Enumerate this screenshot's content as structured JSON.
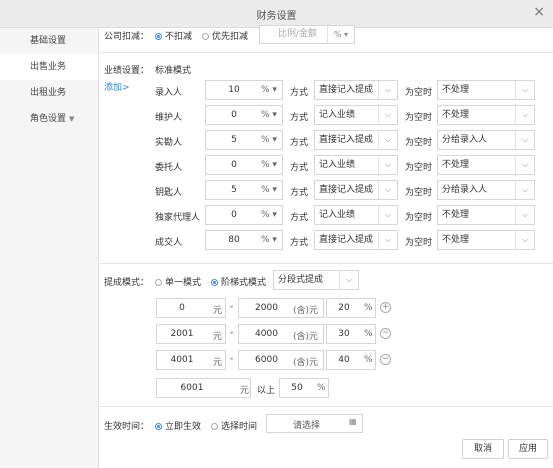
{
  "window": {
    "title": "财务设置",
    "close": "×"
  },
  "sidebar": {
    "items": [
      {
        "label": "基础设置"
      },
      {
        "label": "出售业务"
      },
      {
        "label": "出租业务"
      },
      {
        "label": "角色设置"
      }
    ],
    "caret": "▼"
  },
  "deduction": {
    "label": "公司扣减：",
    "opt1": "不扣减",
    "opt2": "优先扣减",
    "placeholder": "比例/金额",
    "unit": "% ▾"
  },
  "performance": {
    "label": "业绩设置：",
    "mode": "标准模式",
    "add": "添加>",
    "fangshi": "方式",
    "empty_label": "为空时",
    "unit": "% ▾",
    "rows": [
      {
        "role": "录入人",
        "value": "10",
        "method": "直接记入提成",
        "empty": "不处理"
      },
      {
        "role": "维护人",
        "value": "0",
        "method": "记入业绩",
        "empty": "不处理"
      },
      {
        "role": "实勘人",
        "value": "5",
        "method": "直接记入提成",
        "empty": "分给录入人"
      },
      {
        "role": "委托人",
        "value": "0",
        "method": "记入业绩",
        "empty": "不处理"
      },
      {
        "role": "钥匙人",
        "value": "5",
        "method": "直接记入提成",
        "empty": "分给录入人"
      },
      {
        "role": "独家代理人",
        "value": "0",
        "method": "记入业绩",
        "empty": "不处理"
      },
      {
        "role": "成交人",
        "value": "80",
        "method": "直接记入提成",
        "empty": "不处理"
      }
    ]
  },
  "commission": {
    "label": "提成模式：",
    "opt1": "单一模式",
    "opt2": "阶梯式模式",
    "select": "分段式提成",
    "yuan": "元",
    "dash": "-",
    "inclusive": "(含)元",
    "percent": "%",
    "tiers": [
      {
        "from": "0",
        "to": "2000",
        "rate": "20",
        "action": "+"
      },
      {
        "from": "2001",
        "to": "4000",
        "rate": "30",
        "action": "−"
      },
      {
        "from": "4001",
        "to": "6000",
        "rate": "40",
        "action": "−"
      }
    ],
    "last": {
      "from": "6001",
      "above": "以上",
      "rate": "50"
    }
  },
  "effective": {
    "label": "生效时间：",
    "opt1": "立即生效",
    "opt2": "选择时间",
    "placeholder": "请选择",
    "calendar": "📅"
  },
  "footer": {
    "cancel": "取消",
    "apply": "应用"
  }
}
